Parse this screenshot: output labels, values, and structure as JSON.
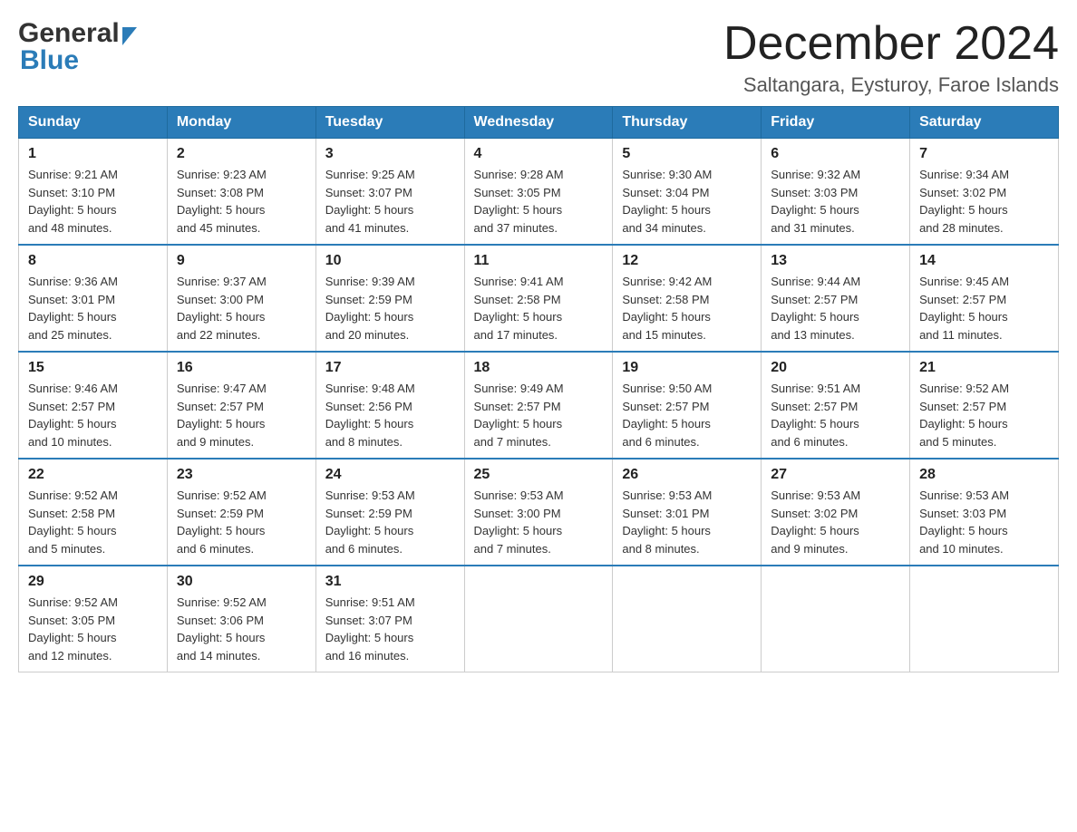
{
  "header": {
    "logo_general": "General",
    "logo_blue": "Blue",
    "main_title": "December 2024",
    "subtitle": "Saltangara, Eysturoy, Faroe Islands"
  },
  "calendar": {
    "days_of_week": [
      "Sunday",
      "Monday",
      "Tuesday",
      "Wednesday",
      "Thursday",
      "Friday",
      "Saturday"
    ],
    "weeks": [
      [
        {
          "day": "1",
          "sunrise": "Sunrise: 9:21 AM",
          "sunset": "Sunset: 3:10 PM",
          "daylight": "Daylight: 5 hours",
          "daylight2": "and 48 minutes."
        },
        {
          "day": "2",
          "sunrise": "Sunrise: 9:23 AM",
          "sunset": "Sunset: 3:08 PM",
          "daylight": "Daylight: 5 hours",
          "daylight2": "and 45 minutes."
        },
        {
          "day": "3",
          "sunrise": "Sunrise: 9:25 AM",
          "sunset": "Sunset: 3:07 PM",
          "daylight": "Daylight: 5 hours",
          "daylight2": "and 41 minutes."
        },
        {
          "day": "4",
          "sunrise": "Sunrise: 9:28 AM",
          "sunset": "Sunset: 3:05 PM",
          "daylight": "Daylight: 5 hours",
          "daylight2": "and 37 minutes."
        },
        {
          "day": "5",
          "sunrise": "Sunrise: 9:30 AM",
          "sunset": "Sunset: 3:04 PM",
          "daylight": "Daylight: 5 hours",
          "daylight2": "and 34 minutes."
        },
        {
          "day": "6",
          "sunrise": "Sunrise: 9:32 AM",
          "sunset": "Sunset: 3:03 PM",
          "daylight": "Daylight: 5 hours",
          "daylight2": "and 31 minutes."
        },
        {
          "day": "7",
          "sunrise": "Sunrise: 9:34 AM",
          "sunset": "Sunset: 3:02 PM",
          "daylight": "Daylight: 5 hours",
          "daylight2": "and 28 minutes."
        }
      ],
      [
        {
          "day": "8",
          "sunrise": "Sunrise: 9:36 AM",
          "sunset": "Sunset: 3:01 PM",
          "daylight": "Daylight: 5 hours",
          "daylight2": "and 25 minutes."
        },
        {
          "day": "9",
          "sunrise": "Sunrise: 9:37 AM",
          "sunset": "Sunset: 3:00 PM",
          "daylight": "Daylight: 5 hours",
          "daylight2": "and 22 minutes."
        },
        {
          "day": "10",
          "sunrise": "Sunrise: 9:39 AM",
          "sunset": "Sunset: 2:59 PM",
          "daylight": "Daylight: 5 hours",
          "daylight2": "and 20 minutes."
        },
        {
          "day": "11",
          "sunrise": "Sunrise: 9:41 AM",
          "sunset": "Sunset: 2:58 PM",
          "daylight": "Daylight: 5 hours",
          "daylight2": "and 17 minutes."
        },
        {
          "day": "12",
          "sunrise": "Sunrise: 9:42 AM",
          "sunset": "Sunset: 2:58 PM",
          "daylight": "Daylight: 5 hours",
          "daylight2": "and 15 minutes."
        },
        {
          "day": "13",
          "sunrise": "Sunrise: 9:44 AM",
          "sunset": "Sunset: 2:57 PM",
          "daylight": "Daylight: 5 hours",
          "daylight2": "and 13 minutes."
        },
        {
          "day": "14",
          "sunrise": "Sunrise: 9:45 AM",
          "sunset": "Sunset: 2:57 PM",
          "daylight": "Daylight: 5 hours",
          "daylight2": "and 11 minutes."
        }
      ],
      [
        {
          "day": "15",
          "sunrise": "Sunrise: 9:46 AM",
          "sunset": "Sunset: 2:57 PM",
          "daylight": "Daylight: 5 hours",
          "daylight2": "and 10 minutes."
        },
        {
          "day": "16",
          "sunrise": "Sunrise: 9:47 AM",
          "sunset": "Sunset: 2:57 PM",
          "daylight": "Daylight: 5 hours",
          "daylight2": "and 9 minutes."
        },
        {
          "day": "17",
          "sunrise": "Sunrise: 9:48 AM",
          "sunset": "Sunset: 2:56 PM",
          "daylight": "Daylight: 5 hours",
          "daylight2": "and 8 minutes."
        },
        {
          "day": "18",
          "sunrise": "Sunrise: 9:49 AM",
          "sunset": "Sunset: 2:57 PM",
          "daylight": "Daylight: 5 hours",
          "daylight2": "and 7 minutes."
        },
        {
          "day": "19",
          "sunrise": "Sunrise: 9:50 AM",
          "sunset": "Sunset: 2:57 PM",
          "daylight": "Daylight: 5 hours",
          "daylight2": "and 6 minutes."
        },
        {
          "day": "20",
          "sunrise": "Sunrise: 9:51 AM",
          "sunset": "Sunset: 2:57 PM",
          "daylight": "Daylight: 5 hours",
          "daylight2": "and 6 minutes."
        },
        {
          "day": "21",
          "sunrise": "Sunrise: 9:52 AM",
          "sunset": "Sunset: 2:57 PM",
          "daylight": "Daylight: 5 hours",
          "daylight2": "and 5 minutes."
        }
      ],
      [
        {
          "day": "22",
          "sunrise": "Sunrise: 9:52 AM",
          "sunset": "Sunset: 2:58 PM",
          "daylight": "Daylight: 5 hours",
          "daylight2": "and 5 minutes."
        },
        {
          "day": "23",
          "sunrise": "Sunrise: 9:52 AM",
          "sunset": "Sunset: 2:59 PM",
          "daylight": "Daylight: 5 hours",
          "daylight2": "and 6 minutes."
        },
        {
          "day": "24",
          "sunrise": "Sunrise: 9:53 AM",
          "sunset": "Sunset: 2:59 PM",
          "daylight": "Daylight: 5 hours",
          "daylight2": "and 6 minutes."
        },
        {
          "day": "25",
          "sunrise": "Sunrise: 9:53 AM",
          "sunset": "Sunset: 3:00 PM",
          "daylight": "Daylight: 5 hours",
          "daylight2": "and 7 minutes."
        },
        {
          "day": "26",
          "sunrise": "Sunrise: 9:53 AM",
          "sunset": "Sunset: 3:01 PM",
          "daylight": "Daylight: 5 hours",
          "daylight2": "and 8 minutes."
        },
        {
          "day": "27",
          "sunrise": "Sunrise: 9:53 AM",
          "sunset": "Sunset: 3:02 PM",
          "daylight": "Daylight: 5 hours",
          "daylight2": "and 9 minutes."
        },
        {
          "day": "28",
          "sunrise": "Sunrise: 9:53 AM",
          "sunset": "Sunset: 3:03 PM",
          "daylight": "Daylight: 5 hours",
          "daylight2": "and 10 minutes."
        }
      ],
      [
        {
          "day": "29",
          "sunrise": "Sunrise: 9:52 AM",
          "sunset": "Sunset: 3:05 PM",
          "daylight": "Daylight: 5 hours",
          "daylight2": "and 12 minutes."
        },
        {
          "day": "30",
          "sunrise": "Sunrise: 9:52 AM",
          "sunset": "Sunset: 3:06 PM",
          "daylight": "Daylight: 5 hours",
          "daylight2": "and 14 minutes."
        },
        {
          "day": "31",
          "sunrise": "Sunrise: 9:51 AM",
          "sunset": "Sunset: 3:07 PM",
          "daylight": "Daylight: 5 hours",
          "daylight2": "and 16 minutes."
        },
        {
          "day": "",
          "sunrise": "",
          "sunset": "",
          "daylight": "",
          "daylight2": ""
        },
        {
          "day": "",
          "sunrise": "",
          "sunset": "",
          "daylight": "",
          "daylight2": ""
        },
        {
          "day": "",
          "sunrise": "",
          "sunset": "",
          "daylight": "",
          "daylight2": ""
        },
        {
          "day": "",
          "sunrise": "",
          "sunset": "",
          "daylight": "",
          "daylight2": ""
        }
      ]
    ]
  }
}
